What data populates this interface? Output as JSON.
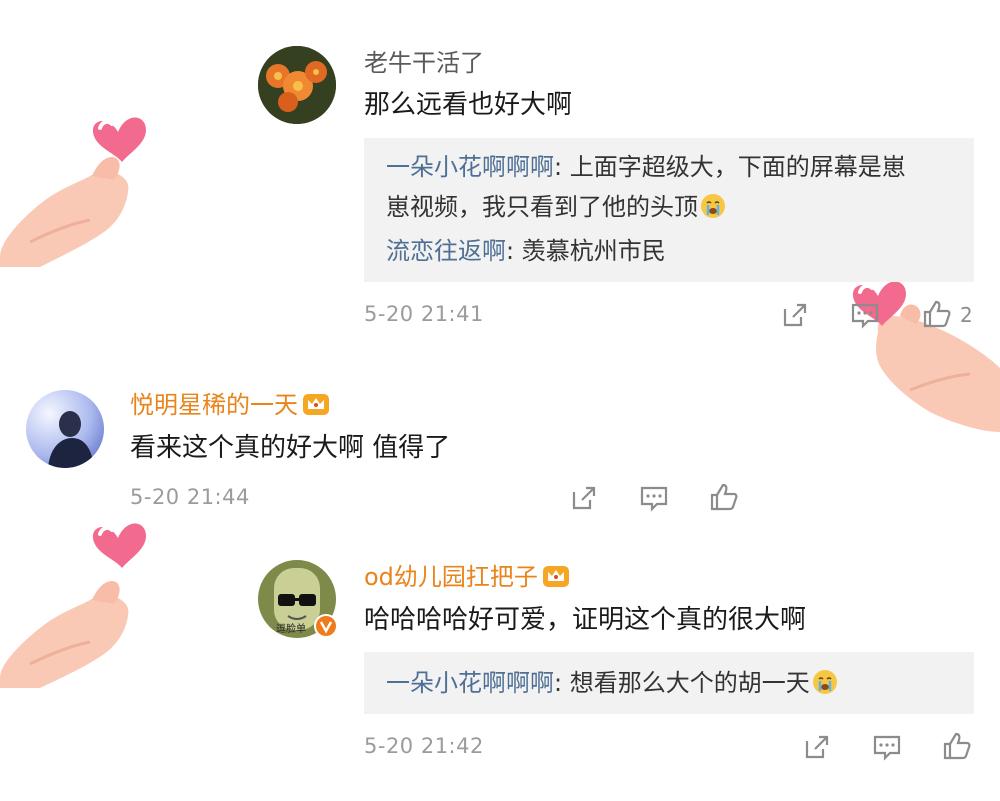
{
  "comments": [
    {
      "author": "老牛干活了",
      "text": "那么远看也好大啊",
      "replies": [
        {
          "name": "一朵小花啊啊啊",
          "text_line1": "上面字超级大，下面的屏幕是崽",
          "text_line2": "崽视频，我只看到了他的头顶"
        },
        {
          "name": "流恋往返啊",
          "text": "羡慕杭州市民"
        }
      ],
      "time": "5-20 21:41",
      "like_count": "2"
    },
    {
      "author": "悦明星稀的一天",
      "text": "看来这个真的好大啊 值得了",
      "time": "5-20 21:44"
    },
    {
      "author": "od幼儿园扛把子",
      "text": "哈哈哈哈好可爱，证明这个真的很大啊",
      "avatar_caption": "逗脸单",
      "replies": [
        {
          "name": "一朵小花啊啊啊",
          "text": "想看那么大个的胡一天"
        }
      ],
      "time": "5-20 21:42"
    }
  ],
  "colors": {
    "name_gray": "#5a5a5a",
    "name_vip_orange": "#e9841c",
    "reply_name_blue": "#4f7095",
    "quote_bg": "#f2f2f2",
    "timestamp_gray": "#9b9b9b",
    "icon_gray": "#8c8c8c",
    "heart_pink": "#f26a8d",
    "hand_peach": "#f9c9b6",
    "verified_orange": "#f07b1c"
  },
  "icons": [
    "share-icon",
    "comment-icon",
    "like-icon",
    "vip-crown-icon",
    "crying-emoji-icon",
    "finger-heart-sticker",
    "verified-badge-icon"
  ]
}
